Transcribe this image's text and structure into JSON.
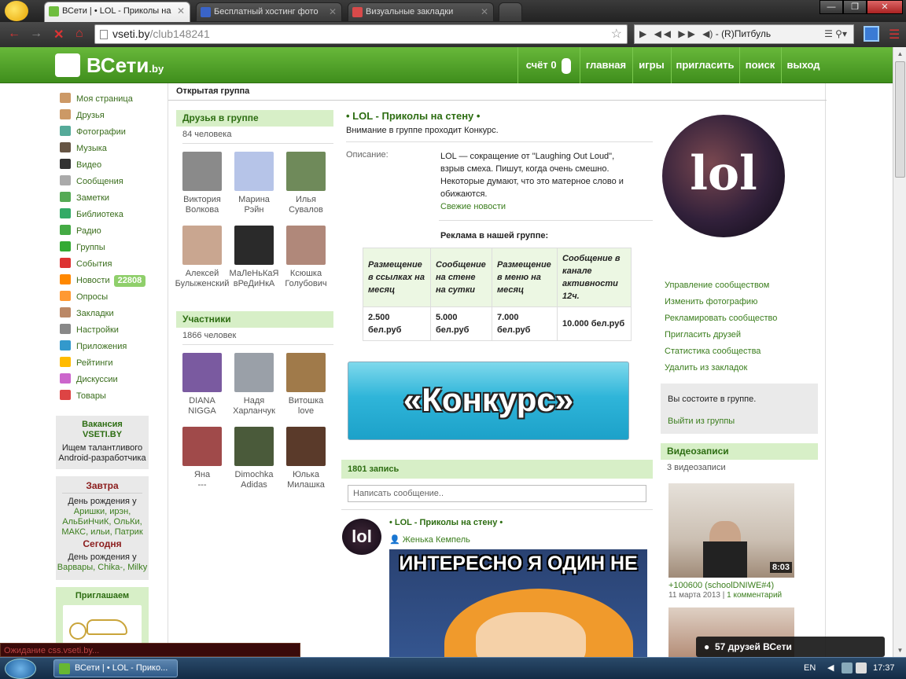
{
  "browser": {
    "tabs": [
      {
        "label": "ВСети | • LOL - Приколы на",
        "active": true
      },
      {
        "label": "Бесплатный хостинг фото",
        "active": false
      },
      {
        "label": "Визуальные закладки",
        "active": false
      }
    ],
    "url_host": "vseti.by",
    "url_path": "/club148241",
    "player_text": "- (R)Питбуль",
    "window_controls": [
      "—",
      "❐",
      "✕"
    ]
  },
  "site": {
    "logo": "ВСети",
    "logo_domain": ".by",
    "nav": {
      "score_label": "счёт 0",
      "items": [
        "главная",
        "игры",
        "пригласить",
        "поиск",
        "выход"
      ]
    }
  },
  "sidebar": {
    "items": [
      {
        "label": "Моя страница",
        "icon": "home-icon",
        "color": "#c96"
      },
      {
        "label": "Друзья",
        "icon": "friends-icon",
        "color": "#c96"
      },
      {
        "label": "Фотографии",
        "icon": "photos-icon",
        "color": "#5a9"
      },
      {
        "label": "Музыка",
        "icon": "music-icon",
        "color": "#654"
      },
      {
        "label": "Видео",
        "icon": "video-icon",
        "color": "#333"
      },
      {
        "label": "Сообщения",
        "icon": "messages-icon",
        "color": "#aaa"
      },
      {
        "label": "Заметки",
        "icon": "notes-icon",
        "color": "#5a5"
      },
      {
        "label": "Библиотека",
        "icon": "library-icon",
        "color": "#3a6"
      },
      {
        "label": "Радио",
        "icon": "radio-icon",
        "color": "#4a4"
      },
      {
        "label": "Группы",
        "icon": "groups-icon",
        "color": "#3a3"
      },
      {
        "label": "События",
        "icon": "events-icon",
        "color": "#d33"
      },
      {
        "label": "Новости",
        "icon": "rss-icon",
        "color": "#f80"
      },
      {
        "label": "Опросы",
        "icon": "polls-icon",
        "color": "#f93"
      },
      {
        "label": "Закладки",
        "icon": "bookmarks-icon",
        "color": "#b86"
      },
      {
        "label": "Настройки",
        "icon": "settings-icon",
        "color": "#888"
      },
      {
        "label": "Приложения",
        "icon": "apps-icon",
        "color": "#39c"
      },
      {
        "label": "Рейтинги",
        "icon": "star-icon",
        "color": "#fb0"
      },
      {
        "label": "Дискуссии",
        "icon": "discussions-icon",
        "color": "#c6c"
      },
      {
        "label": "Товары",
        "icon": "shop-icon",
        "color": "#d44"
      }
    ],
    "news_count": "22808",
    "job": {
      "title": "Вакансия VSETI.BY",
      "text": "Ищем талантливого Android-разработчика"
    },
    "birthdays": {
      "tomorrow_title": "Завтра",
      "tomorrow_prefix": "День рождения у",
      "tomorrow_names": "Аришки, ирэн, АльБиНчиК, ОльКи, МАКС, ильи, Патрик",
      "today_title": "Сегодня",
      "today_prefix": "День рождения у",
      "today_names": "Варвары, Chika-, Milky"
    },
    "invite_title": "Приглашаем"
  },
  "group": {
    "type_label": "Открытая группа",
    "title": "• LOL - Приколы на стену •",
    "note": "Внимание в группе проходит Конкурс.",
    "desc_label": "Описание:",
    "desc_text": "LOL — сокращение от \"Laughing Out Loud\", взрыв смеха. Пишут, когда очень смешно. Некоторые думают, что это матерное слово и обижаются.",
    "news_link": "Свежие новости",
    "ad_title": "Реклама в нашей группе:",
    "ad_headers": [
      "Размещение в ссылках на месяц",
      "Сообщение на стене на сутки",
      "Размещение в меню на месяц",
      "Сообщение в канале активности 12ч."
    ],
    "ad_prices": [
      "2.500 бел.руб",
      "5.000 бел.руб",
      "7.000 бел.руб",
      "10.000 бел.руб"
    ],
    "banner_text": "«Конкурс»",
    "image_text": "lol"
  },
  "friends": {
    "title": "Друзья в группе",
    "count": "84 человека",
    "list": [
      {
        "first": "Виктория",
        "last": "Волкова",
        "color": "#8a8a8a"
      },
      {
        "first": "Марина",
        "last": "Рэйн",
        "color": "#b6c4e8"
      },
      {
        "first": "Илья",
        "last": "Сувалов",
        "color": "#6f8a5a"
      },
      {
        "first": "Алексей",
        "last": "Булыженский",
        "color": "#c9a690"
      },
      {
        "first": "МаЛеНьКаЯ",
        "last": "вРеДиНкА",
        "color": "#2a2a2a"
      },
      {
        "first": "Ксюшка",
        "last": "Голубович",
        "color": "#b0887a"
      }
    ]
  },
  "members": {
    "title": "Участники",
    "count": "1866 человек",
    "list": [
      {
        "first": "DIANA",
        "last": "NIGGA",
        "color": "#7a5aa0"
      },
      {
        "first": "Надя",
        "last": "Харланчук",
        "color": "#9aa0a8"
      },
      {
        "first": "Витошка",
        "last": "love",
        "color": "#a07a4a"
      },
      {
        "first": "Яна",
        "last": "---",
        "color": "#a04a4a"
      },
      {
        "first": "Dimochka",
        "last": "Adidas",
        "color": "#4a5a3a"
      },
      {
        "first": "Юлька",
        "last": "Милашка",
        "color": "#5a3a2a"
      }
    ]
  },
  "wall": {
    "count_label": "1801 запись",
    "input_placeholder": "Написать сообщение..",
    "post_title": "• LOL - Приколы на стену •",
    "post_author": "Женька Кемпель",
    "post_avatar_text": "lol",
    "meme_text": "ИНТЕРЕСНО Я ОДИН НЕ"
  },
  "right": {
    "links": [
      "Управление сообществом",
      "Изменить фотографию",
      "Рекламировать сообщество",
      "Пригласить друзей",
      "Статистика сообщества",
      "Удалить из закладок"
    ],
    "member_status": "Вы состоите в группе.",
    "leave_link": "Выйти из группы",
    "videos_title": "Видеозаписи",
    "videos_count": "3 видеозаписи",
    "video_duration": "8:03",
    "video_title": "+100600 (schoolDNIWE#4)",
    "video_date": "11 марта 2013",
    "video_comments": "1 комментарий"
  },
  "popup": {
    "friends_online": "57 друзей ВСети"
  },
  "statusbar": {
    "text": "Ожидание css.vseti.by..."
  },
  "taskbar": {
    "task_label": "ВСети | • LOL - Прико...",
    "lang": "EN",
    "time": "17:37"
  }
}
